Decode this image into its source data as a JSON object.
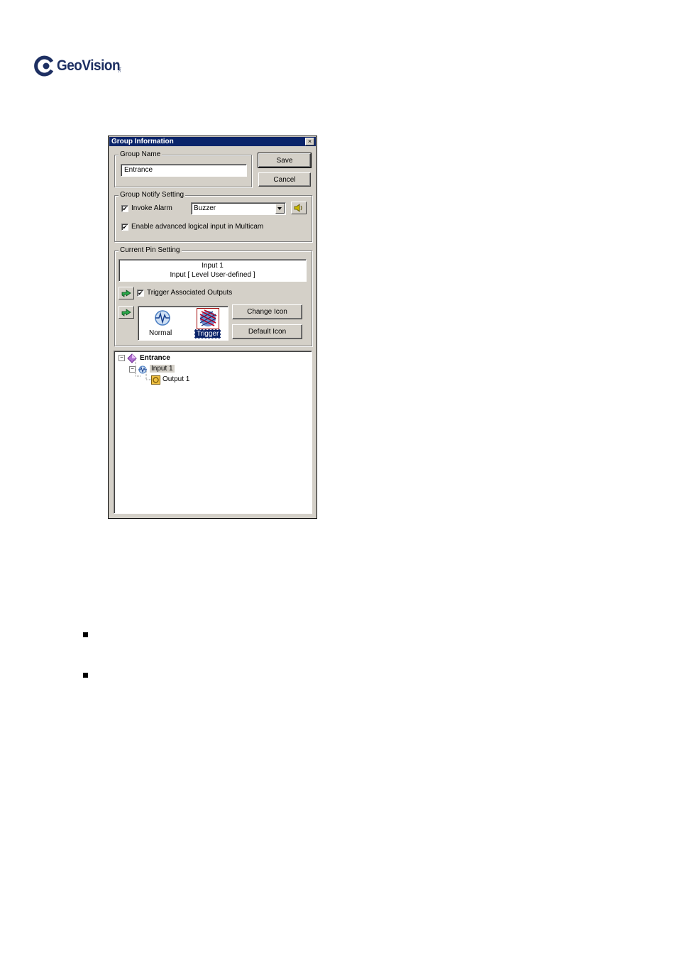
{
  "logo": {
    "text": "GeoVision",
    "suffix": "Inc."
  },
  "window": {
    "title": "Group Information",
    "close_glyph": "×"
  },
  "group_name": {
    "legend": "Group Name",
    "value": "Entrance"
  },
  "buttons": {
    "save": "Save",
    "cancel": "Cancel",
    "change_icon": "Change Icon",
    "default_icon": "Default Icon"
  },
  "notify": {
    "legend": "Group Notify Setting",
    "invoke_alarm_label": "Invoke Alarm",
    "invoke_alarm_checked": true,
    "alarm_select_value": "Buzzer",
    "advanced_label": "Enable advanced logical input in Multicam",
    "advanced_checked": true,
    "check_glyph": "✔"
  },
  "pin": {
    "legend": "Current Pin Setting",
    "line1": "Input 1",
    "line2": "Input [ Level User-defined ]",
    "trigger_outputs_label": "Trigger Associated Outputs",
    "trigger_outputs_checked": true,
    "icon_normal_label": "Normal",
    "icon_trigger_label": "Trigger"
  },
  "tree": {
    "root": "Entrance",
    "child": "Input 1",
    "grandchild": "Output 1",
    "collapse_glyph": "−"
  },
  "icons": {
    "logo": "geovision-logo-icon",
    "speaker": "speaker-icon",
    "arrow": "green-arrow-icon",
    "normal": "normal-input-icon",
    "trigger": "trigger-input-icon",
    "group": "purple-diamond-icon",
    "input": "input-icon",
    "output": "output-icon"
  },
  "colors": {
    "titlebar": "#0a246a",
    "selection": "#0a246a",
    "face": "#d4d0c8"
  }
}
